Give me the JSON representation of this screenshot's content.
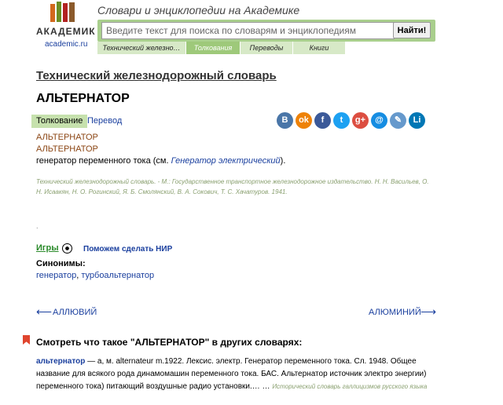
{
  "header": {
    "logo_word": "АКАДЕМИК",
    "logo_site": "academic.ru",
    "tagline": "Словари и энциклопедии на Академике",
    "search_placeholder": "Введите текст для поиска по словарям и энциклопедиям",
    "search_button": "Найти!",
    "tabs": [
      {
        "label": "Технический железно…",
        "active": false
      },
      {
        "label": "Толкования",
        "active": true
      },
      {
        "label": "Переводы",
        "active": false
      },
      {
        "label": "Книги",
        "active": false
      }
    ]
  },
  "article": {
    "dictionary_title": "Технический железнодорожный словарь",
    "headword": "АЛЬТЕРНАТОР",
    "tab_meaning": "Толкование",
    "tab_translation": "Перевод",
    "entry_line_1": "АЛЬТЕРНАТОР",
    "entry_line_2": "АЛЬТЕРНАТОР",
    "definition_prefix": "генератор переменного тока (см. ",
    "definition_link": "Генератор электрический",
    "definition_suffix": ").",
    "source": "Технический железнодорожный словарь. - М.: Государственное транспортное железнодорожное издательство. Н. Н. Васильев, О. Н. Исаакян, Н. О. Рогинский, Я. Б. Смолянский, В. А. Сокович, Т. С. Хачатуров. 1941.",
    "dot": "."
  },
  "share_icons": [
    {
      "icon": "vk-icon",
      "glyph": "В",
      "color": "#4a76a8"
    },
    {
      "icon": "odnoklassniki-icon",
      "glyph": "ok",
      "color": "#ee8208"
    },
    {
      "icon": "facebook-icon",
      "glyph": "f",
      "color": "#3b5998"
    },
    {
      "icon": "twitter-icon",
      "glyph": "t",
      "color": "#1da1f2"
    },
    {
      "icon": "google-plus-icon",
      "glyph": "g+",
      "color": "#dc4e41"
    },
    {
      "icon": "mail-icon",
      "glyph": "@",
      "color": "#168de2"
    },
    {
      "icon": "livejournal-icon",
      "glyph": "✎",
      "color": "#6699cc"
    },
    {
      "icon": "linkedin-icon",
      "glyph": "Li",
      "color": "#0077b5"
    }
  ],
  "extras": {
    "games_label": "Игры",
    "help_link": "Поможем сделать НИР",
    "synonyms_label": "Синонимы:",
    "synonym_1": "генератор",
    "synonym_separator": ", ",
    "synonym_2": "турбоальтернатор"
  },
  "navigation": {
    "prev_arrow": "⟵",
    "prev_label": "АЛЛЮВИЙ",
    "next_label": "АЛЮМИНИЙ",
    "next_arrow": "⟶"
  },
  "other_dictionaries": {
    "heading": "Смотреть что такое \"АЛЬТЕРНАТОР\" в других словарях:",
    "entry_link": "альтернатор",
    "entry_text": " — а, м. alternateur m.1922. Лексис. электр. Генератор переменного тока. Сл. 1948. Общее название для всякого рода динамомашин переменного тока. БАС. Альтернатор источник электро энергии) переменного тока) питающий воздушные радио установки.… … ",
    "entry_source": "Исторический словарь галлицизмов русского языка"
  },
  "colors": {
    "accent_green": "#a9cf8d",
    "link_blue": "#1a3f9e",
    "entry_brown": "#8b4513",
    "source_green": "#8aa070"
  }
}
